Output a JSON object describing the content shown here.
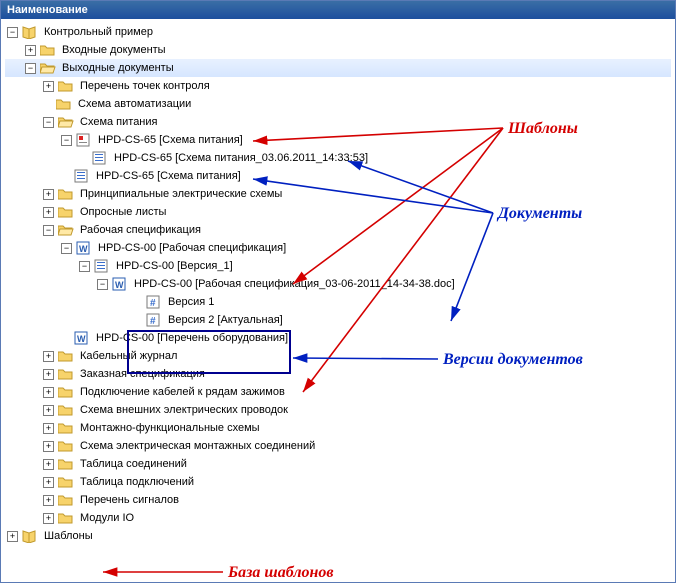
{
  "header": {
    "title": "Наименование"
  },
  "tree": {
    "root": "Контрольный пример",
    "input": "Входные документы",
    "output": "Выходные документы",
    "out_items": {
      "points": "Перечень точек контроля",
      "auto": "Схема автоматизации",
      "power": "Схема питания",
      "princ": "Принципиальные электрические схемы",
      "sheets": "Опросные листы",
      "workspec": "Рабочая спецификация",
      "cable": "Кабельный журнал",
      "order": "Заказная спецификация",
      "conncab": "Подключение кабелей к рядам зажимов",
      "extwire": "Схема внешних электрических проводок",
      "funcsch": "Монтажно-функциональные схемы",
      "mountsch": "Схема электрическая монтажных соединений",
      "tabconn": "Таблица соединений",
      "tabpodk": "Таблица подключений",
      "siglist": "Перечень сигналов",
      "io": "Модули IO"
    },
    "power_children": {
      "tpl": "HPD-CS-65 [Схема питания]",
      "docts": "HPD-CS-65 [Схема питания_03.06.2011_14:33:53]",
      "doc": "HPD-CS-65 [Схема питания]"
    },
    "work_children": {
      "tpl": "HPD-CS-00 [Рабочая спецификация]",
      "ver1": "HPD-CS-00 [Версия_1]",
      "doc": "HPD-CS-00 [Рабочая спецификация_03-06-2011_14-34-38.doc]",
      "v1": "Версия 1",
      "v2": "Версия 2 [Актуальная]",
      "eqlist": "HPD-CS-00 [Перечень оборудования]"
    },
    "templates": "Шаблоны"
  },
  "annotations": {
    "tpl": "Шаблоны",
    "docs": "Документы",
    "vers": "Версии документов",
    "base": "База шаблонов"
  }
}
